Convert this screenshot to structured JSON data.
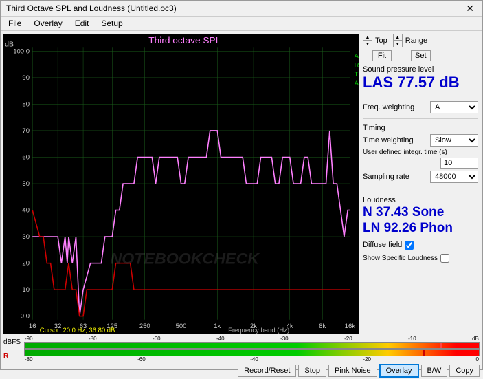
{
  "window": {
    "title": "Third Octave SPL and Loudness (Untitled.oc3)",
    "close_label": "✕"
  },
  "menu": {
    "items": [
      "File",
      "Overlay",
      "Edit",
      "Setup"
    ]
  },
  "chart": {
    "title": "Third octave SPL",
    "y_label": "dB",
    "arta_lines": [
      "A",
      "R",
      "T",
      "A"
    ],
    "cursor_info": "Cursor:  20.0 Hz, 36.80 dB",
    "freq_band_label": "Frequency band (Hz)",
    "y_ticks": [
      "100.0",
      "90",
      "80",
      "70",
      "60",
      "50",
      "40",
      "30",
      "20",
      "10",
      "0.0"
    ],
    "x_ticks": [
      "16",
      "32",
      "63",
      "125",
      "250",
      "500",
      "1k",
      "2k",
      "4k",
      "8k",
      "16k"
    ]
  },
  "controls": {
    "top_label": "Top",
    "fit_label": "Fit",
    "range_label": "Range",
    "set_label": "Set"
  },
  "spl": {
    "section_label": "Sound pressure level",
    "value": "LAS 77.57 dB",
    "freq_weighting_label": "Freq. weighting",
    "freq_weighting_value": "A"
  },
  "timing": {
    "section_label": "Timing",
    "time_weighting_label": "Time weighting",
    "time_weighting_value": "Slow",
    "integr_time_label": "User defined integr. time (s)",
    "integr_time_value": "10",
    "sampling_rate_label": "Sampling rate",
    "sampling_rate_value": "48000"
  },
  "loudness": {
    "section_label": "Loudness",
    "value_line1": "N 37.43 Sone",
    "value_line2": "LN 92.26 Phon",
    "diffuse_field_label": "Diffuse field",
    "diffuse_field_checked": true,
    "show_specific_label": "Show Specific Loudness",
    "show_specific_checked": false
  },
  "meter": {
    "dBFS_label": "dBFS",
    "r_label": "R",
    "tick_labels": [
      "-90",
      "-80",
      "-60",
      "-40",
      "-30",
      "-20",
      "-10",
      "dB"
    ],
    "r_tick_labels": [
      "-80",
      "-60",
      "-40",
      "-20",
      "0"
    ],
    "db_end": "dB"
  },
  "buttons": {
    "record_reset": "Record/Reset",
    "stop": "Stop",
    "pink_noise": "Pink Noise",
    "overlay": "Overlay",
    "bw": "B/W",
    "copy": "Copy"
  },
  "watermark": "NOTEBOOKCHECK"
}
